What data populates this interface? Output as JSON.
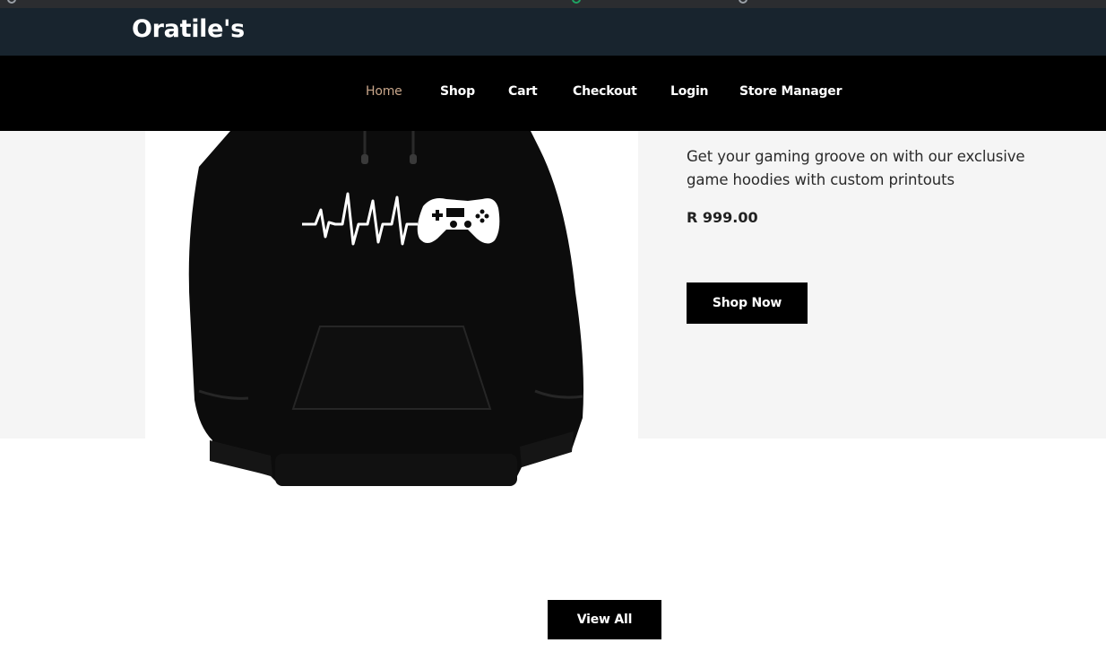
{
  "browser": {
    "icons": [
      "tab-icon",
      "extension-icon",
      "profile-icon"
    ]
  },
  "header": {
    "brand": "Oratile's",
    "background": "#18242e"
  },
  "nav": {
    "items": [
      {
        "label": "Home",
        "active": true
      },
      {
        "label": "Shop",
        "active": false
      },
      {
        "label": "Cart",
        "active": false
      },
      {
        "label": "Checkout",
        "active": false
      },
      {
        "label": "Login",
        "active": false
      },
      {
        "label": "Store Manager",
        "active": false
      }
    ],
    "active_color": "#c8a68a"
  },
  "hero": {
    "product_image": "black-gaming-hoodie",
    "description": "Get your gaming groove on with our exclusive game hoodies with custom printouts",
    "price": "R 999.00",
    "cta": "Shop Now"
  },
  "footer_action": {
    "label": "View All"
  }
}
